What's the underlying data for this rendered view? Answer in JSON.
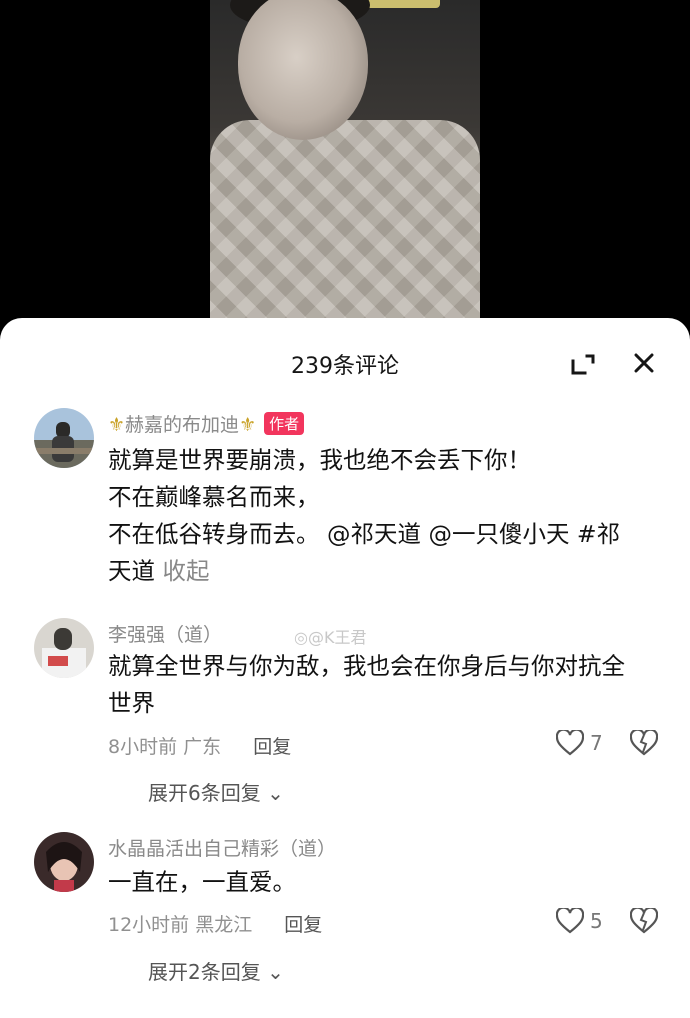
{
  "video": {
    "caption": ""
  },
  "sheet": {
    "comment_count_title": "239条评论",
    "expand_icon": "fullscreen-icon",
    "close_icon": "close-icon"
  },
  "watermark": "@K王君",
  "comments": [
    {
      "username": "赫嘉的布加迪",
      "username_decor": "⚜",
      "author_badge": "作者",
      "line1": "就算是世界要崩溃，我也绝不会丢下你！",
      "line2": "不在巅峰慕名而来，",
      "line3": "不在低谷转身而去。 @祁天道 @一只傻小天 #祁",
      "line4": "天道",
      "collapse": "收起"
    },
    {
      "username": "李强强（道）",
      "line1": "就算全世界与你为敌，我也会在你身后与你对抗全",
      "line2": "世界",
      "time": "8小时前",
      "location": "广东",
      "reply": "回复",
      "likes": "7",
      "expand_replies": "展开6条回复 ⌄"
    },
    {
      "username": "水晶晶活出自己精彩（道）",
      "line1": "一直在，一直爱。",
      "time": "12小时前",
      "location": "黑龙江",
      "reply": "回复",
      "likes": "5",
      "expand_replies": "展开2条回复 ⌄"
    }
  ],
  "colors": {
    "author_badge_bg": "#f2355d",
    "sheet_bg": "#ffffff",
    "video_bg": "#000000"
  }
}
